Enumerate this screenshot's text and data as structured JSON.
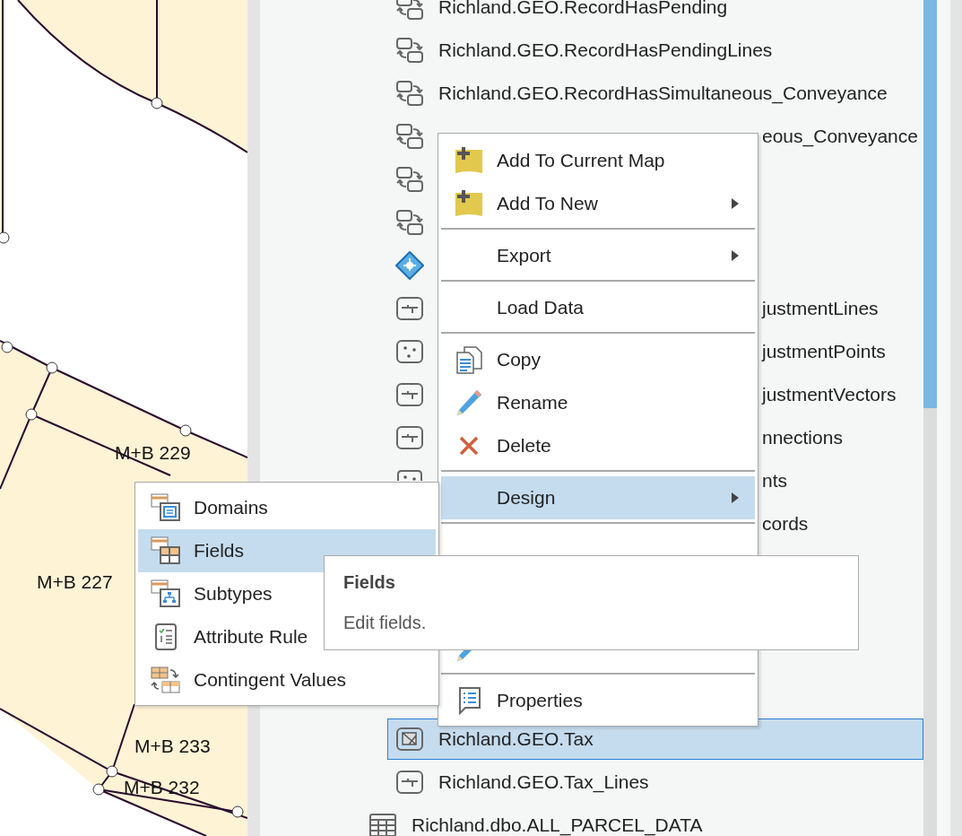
{
  "map": {
    "labels": [
      {
        "text": "M+B 229"
      },
      {
        "text": "M+B 227"
      },
      {
        "text": "M+B 233"
      },
      {
        "text": "M+B 232"
      }
    ]
  },
  "tree": {
    "dataset_children": [
      {
        "kind": "relationship",
        "label": "Richland.GEO.RecordHasPending",
        "label_cut": false,
        "selected": false
      },
      {
        "kind": "relationship",
        "label": "Richland.GEO.RecordHasPendingLines",
        "label_cut": false,
        "selected": false
      },
      {
        "kind": "relationship",
        "label": "Richland.GEO.RecordHasSimultaneous_Conveyance",
        "label_cut": false,
        "selected": false
      },
      {
        "kind": "relationship",
        "label": "eous_Conveyance",
        "label_cut": true,
        "selected": false
      },
      {
        "kind": "relationship",
        "selected": false
      },
      {
        "kind": "relationship",
        "selected": false
      },
      {
        "kind": "topology",
        "selected": false
      },
      {
        "kind": "line",
        "label": "justmentLines",
        "label_cut": true,
        "selected": false
      },
      {
        "kind": "point",
        "label": "justmentPoints",
        "label_cut": true,
        "selected": false
      },
      {
        "kind": "line",
        "label": "justmentVectors",
        "label_cut": true,
        "selected": false
      },
      {
        "kind": "line",
        "label": "nnections",
        "label_cut": true,
        "selected": false
      },
      {
        "kind": "point",
        "label": "nts",
        "label_cut": true,
        "selected": false
      },
      {
        "label": "cords",
        "label_cut": true,
        "selected": false
      },
      {
        "kind": "polygon",
        "label": "Richland.GEO.Tax",
        "label_cut": false,
        "selected": true
      },
      {
        "kind": "line",
        "label": "Richland.GEO.Tax_Lines",
        "label_cut": false,
        "selected": false
      }
    ],
    "items": [
      {
        "kind": "table",
        "label": "Richland.dbo.ALL_PARCEL_DATA",
        "label_cut": false,
        "selected": false
      }
    ]
  },
  "context_menu": {
    "groups": [
      [
        {
          "kind": "add",
          "label": "Add To Current Map",
          "submenu": false,
          "selected": false
        },
        {
          "kind": "add",
          "label": "Add To New",
          "submenu": true,
          "selected": false
        }
      ],
      [
        {
          "label": "Export",
          "submenu": true,
          "selected": false
        }
      ],
      [
        {
          "label": "Load Data",
          "submenu": false,
          "selected": false
        }
      ],
      [
        {
          "kind": "copy",
          "label": "Copy",
          "submenu": false,
          "selected": false
        },
        {
          "kind": "rename",
          "label": "Rename",
          "submenu": false,
          "selected": false
        },
        {
          "kind": "delete",
          "label": "Delete",
          "submenu": false,
          "selected": false
        }
      ],
      [
        {
          "label": "Design",
          "submenu": true,
          "selected": true
        }
      ],
      [
        {
          "kind": "rename",
          "submenu": false,
          "selected": false
        }
      ],
      [
        {
          "kind": "properties",
          "label": "Properties",
          "submenu": false,
          "selected": false
        }
      ]
    ]
  },
  "design_submenu": {
    "items": [
      {
        "kind": "domains",
        "label": "Domains",
        "selected": false
      },
      {
        "kind": "fields",
        "label": "Fields",
        "selected": true
      },
      {
        "kind": "subtypes",
        "label": "Subtypes",
        "selected": false
      },
      {
        "kind": "rules",
        "label": "Attribute Rule",
        "selected": false
      },
      {
        "kind": "contingent",
        "label": "Contingent Values",
        "selected": false
      }
    ]
  },
  "tooltip": {
    "title": "Fields",
    "text": "Edit fields."
  }
}
